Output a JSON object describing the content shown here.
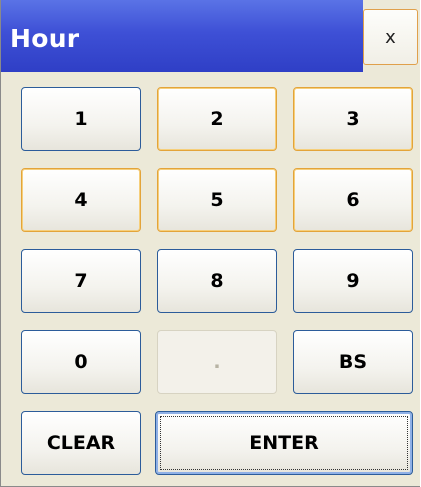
{
  "window": {
    "title": "Hour",
    "close_label": "x"
  },
  "keypad": {
    "k1": "1",
    "k2": "2",
    "k3": "3",
    "k4": "4",
    "k5": "5",
    "k6": "6",
    "k7": "7",
    "k8": "8",
    "k9": "9",
    "k0": "0",
    "decimal": ".",
    "backspace": "BS",
    "clear": "CLEAR",
    "enter": "ENTER"
  },
  "states": {
    "decimal_enabled": false,
    "focused_key": "ENTER"
  }
}
